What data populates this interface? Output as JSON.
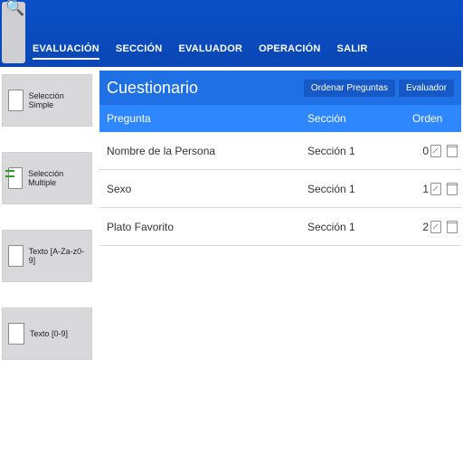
{
  "menu": {
    "items": [
      "EVALUACIÓN",
      "SECCIÓN",
      "EVALUADOR",
      "OPERACIÓN",
      "SALIR"
    ],
    "active_index": 0
  },
  "sidebar": {
    "items": [
      {
        "label": "Selección Simple",
        "icon": "doc"
      },
      {
        "label": "Selección Multiple",
        "icon": "multi"
      },
      {
        "label": "Texto [A-Za-z0-9]",
        "icon": "doc"
      },
      {
        "label": "Texto [0-9]",
        "icon": "doc"
      }
    ]
  },
  "panel": {
    "title": "Cuestionario",
    "actions": [
      "Ordenar Preguntas",
      "Evaluador"
    ],
    "columns": {
      "pregunta": "Pregunta",
      "seccion": "Sección",
      "orden": "Orden"
    },
    "rows": [
      {
        "pregunta": "Nombre de la Persona",
        "seccion": "Sección 1",
        "orden": "0"
      },
      {
        "pregunta": "Sexo",
        "seccion": "Sección 1",
        "orden": "1"
      },
      {
        "pregunta": "Plato Favorito",
        "seccion": "Sección 1",
        "orden": "2"
      }
    ]
  },
  "icons": {
    "search": "🔍"
  }
}
